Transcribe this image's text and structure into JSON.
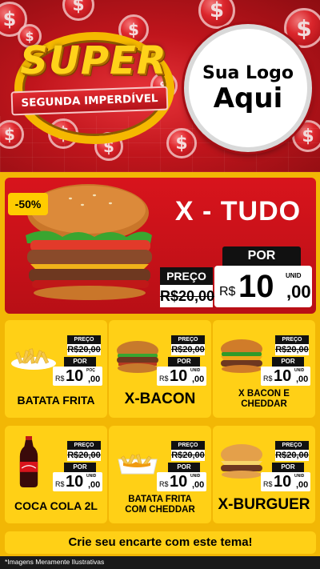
{
  "header": {
    "super_label": "SUPER",
    "ribbon_label": "SEGUNDA IMPERDÍVEL",
    "logo_line1": "Sua Logo",
    "logo_line2": "Aqui",
    "coin_symbol": "$"
  },
  "featured": {
    "discount": "-50%",
    "title": "X - TUDO",
    "preco_label": "PREÇO",
    "old_price": "R$20,00",
    "por_label": "POR",
    "currency": "R$",
    "new_price_int": "10",
    "new_price_dec": ",00",
    "unit": "UNID"
  },
  "products": [
    {
      "name": "BATATA FRITA",
      "preco_label": "PREÇO",
      "old_price": "R$20,00",
      "por_label": "POR",
      "currency": "R$",
      "price_int": "10",
      "price_dec": ",00",
      "unit": "POÇ",
      "icon": "fries-icon"
    },
    {
      "name": "X-BACON",
      "preco_label": "PREÇO",
      "old_price": "R$20,00",
      "por_label": "POR",
      "currency": "R$",
      "price_int": "10",
      "price_dec": ",00",
      "unit": "UNID",
      "icon": "burger-icon"
    },
    {
      "name": "X BACON E CHEDDAR",
      "preco_label": "PREÇO",
      "old_price": "R$20,00",
      "por_label": "POR",
      "currency": "R$",
      "price_int": "10",
      "price_dec": ",00",
      "unit": "UNID",
      "icon": "cheddar-burger-icon"
    },
    {
      "name": "COCA COLA 2L",
      "preco_label": "PREÇO",
      "old_price": "R$20,00",
      "por_label": "POR",
      "currency": "R$",
      "price_int": "10",
      "price_dec": ",00",
      "unit": "UNID",
      "icon": "soda-bottle-icon"
    },
    {
      "name": "BATATA FRITA COM CHEDDAR",
      "preco_label": "PREÇO",
      "old_price": "R$20,00",
      "por_label": "POR",
      "currency": "R$",
      "price_int": "10",
      "price_dec": ",00",
      "unit": "UNID",
      "icon": "cheddar-fries-icon"
    },
    {
      "name": "X-BURGUER",
      "preco_label": "PREÇO",
      "old_price": "R$20,00",
      "por_label": "POR",
      "currency": "R$",
      "price_int": "10",
      "price_dec": ",00",
      "unit": "UNID",
      "icon": "cheeseburger-icon"
    }
  ],
  "cta_label": "Crie seu encarte com este tema!",
  "disclaimer": "*Imagens Meramente Ilustrativas",
  "colors": {
    "red": "#c8141b",
    "yellow": "#f2b705",
    "card_yellow": "#ffd016",
    "gold": "#ffd21a"
  }
}
